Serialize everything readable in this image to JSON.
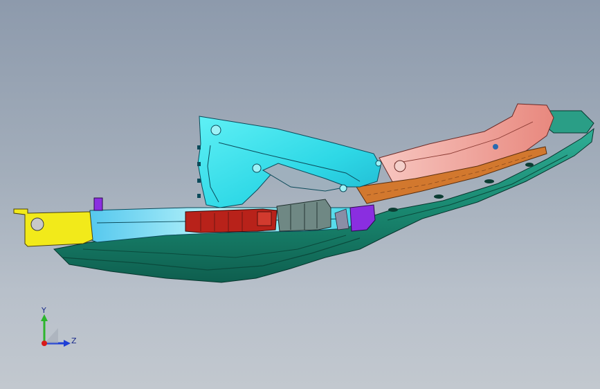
{
  "viewport": {
    "background_top": "#8d9aac",
    "background_bottom": "#c2c8cf"
  },
  "triad": {
    "y_label": "Y",
    "z_label": "Z",
    "y_color": "#2db52d",
    "z_color": "#1f3fd6",
    "origin_color": "#d81a1a"
  },
  "model": {
    "parts": [
      {
        "name": "front-bracket",
        "color": "#f2ea1a"
      },
      {
        "name": "front-rail",
        "color": "#2fe0e8"
      },
      {
        "name": "shock-tower-panel",
        "color": "#3de6f0"
      },
      {
        "name": "wheelhouse-panel",
        "color": "#f0a6a0"
      },
      {
        "name": "reinforcement-strip",
        "color": "#d2782e"
      },
      {
        "name": "lower-rail",
        "color": "#1a8a72"
      },
      {
        "name": "crossmember-section",
        "color": "#b8221a"
      },
      {
        "name": "mid-bracket",
        "color": "#7a8a88"
      },
      {
        "name": "small-bracket",
        "color": "#8a2ee0"
      }
    ]
  }
}
